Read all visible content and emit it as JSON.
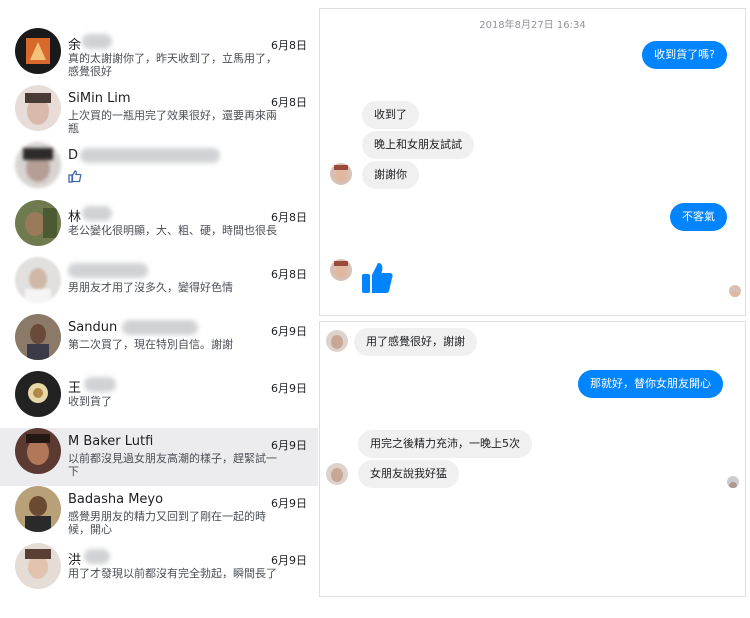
{
  "conversations": [
    {
      "name": "余",
      "date": "6月8日",
      "preview": "真的太謝謝你了，昨天收到了，立馬用了，感覺很好"
    },
    {
      "name": "SiMin Lim",
      "date": "6月8日",
      "preview": "上次買的一瓶用完了效果很好，還要再來兩瓶"
    },
    {
      "name": "D",
      "date": "",
      "preview": "",
      "preview_icon": "thumbs-up-icon"
    },
    {
      "name": "林",
      "date": "6月8日",
      "preview": "老公變化很明顯，大、粗、硬，時間也很長"
    },
    {
      "name": "",
      "date": "6月8日",
      "preview": "男朋友才用了沒多久，變得好色情"
    },
    {
      "name": "Sandun",
      "date": "6月9日",
      "preview": "第二次買了，現在特別自信。謝謝"
    },
    {
      "name": "王",
      "date": "6月9日",
      "preview": "收到貨了"
    },
    {
      "name": "M Baker Lutfi",
      "date": "6月9日",
      "preview": "以前都沒見過女朋友高潮的樣子，趕緊試一下",
      "selected": true
    },
    {
      "name": "Badasha Meyo",
      "date": "6月9日",
      "preview": "感覺男朋友的精力又回到了剛在一起的時候，開心"
    },
    {
      "name": "洪",
      "date": "6月9日",
      "preview": "用了才發現以前都沒有完全勃起，瞬間長了"
    }
  ],
  "chat_top": {
    "timestamp": "2018年8月27日 16:34",
    "msg_out_1": "收到貨了嗎?",
    "msg_in_1": "收到了",
    "msg_in_2": "晚上和女朋友試試",
    "msg_in_3": "謝謝你",
    "msg_out_2": "不客氣",
    "reaction_icon": "thumbs-up-icon"
  },
  "chat_bottom": {
    "msg_in_1": "用了感覺很好，謝謝",
    "msg_out_1": "那就好，替你女朋友開心",
    "msg_in_2": "用完之後精力充沛，一晚上5次",
    "msg_in_3": "女朋友說我好猛"
  },
  "colors": {
    "accent": "#0084ff",
    "bubble_in": "#f1f0f0",
    "selected_row": "#ececee"
  }
}
